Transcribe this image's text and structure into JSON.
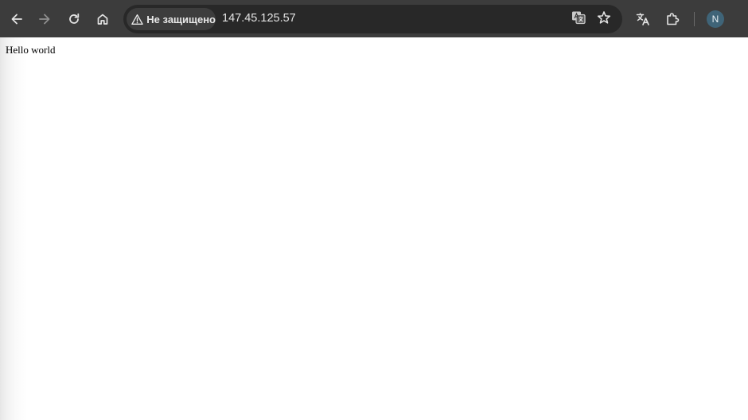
{
  "browser": {
    "security_label": "Не защищено",
    "url": "147.45.125.57",
    "profile_initial": "N",
    "icons": {
      "back": "arrow-left-icon",
      "forward": "arrow-right-icon",
      "reload": "reload-icon",
      "home": "home-icon",
      "warning": "warning-triangle-icon",
      "page_translate": "google-translate-icon",
      "bookmark": "star-icon",
      "translate": "translate-icon",
      "extensions": "puzzle-icon"
    },
    "colors": {
      "toolbar": "#3c3c3c",
      "omnibox": "#282828",
      "avatar": "#3f6478"
    }
  },
  "page": {
    "body_text": "Hello world"
  }
}
